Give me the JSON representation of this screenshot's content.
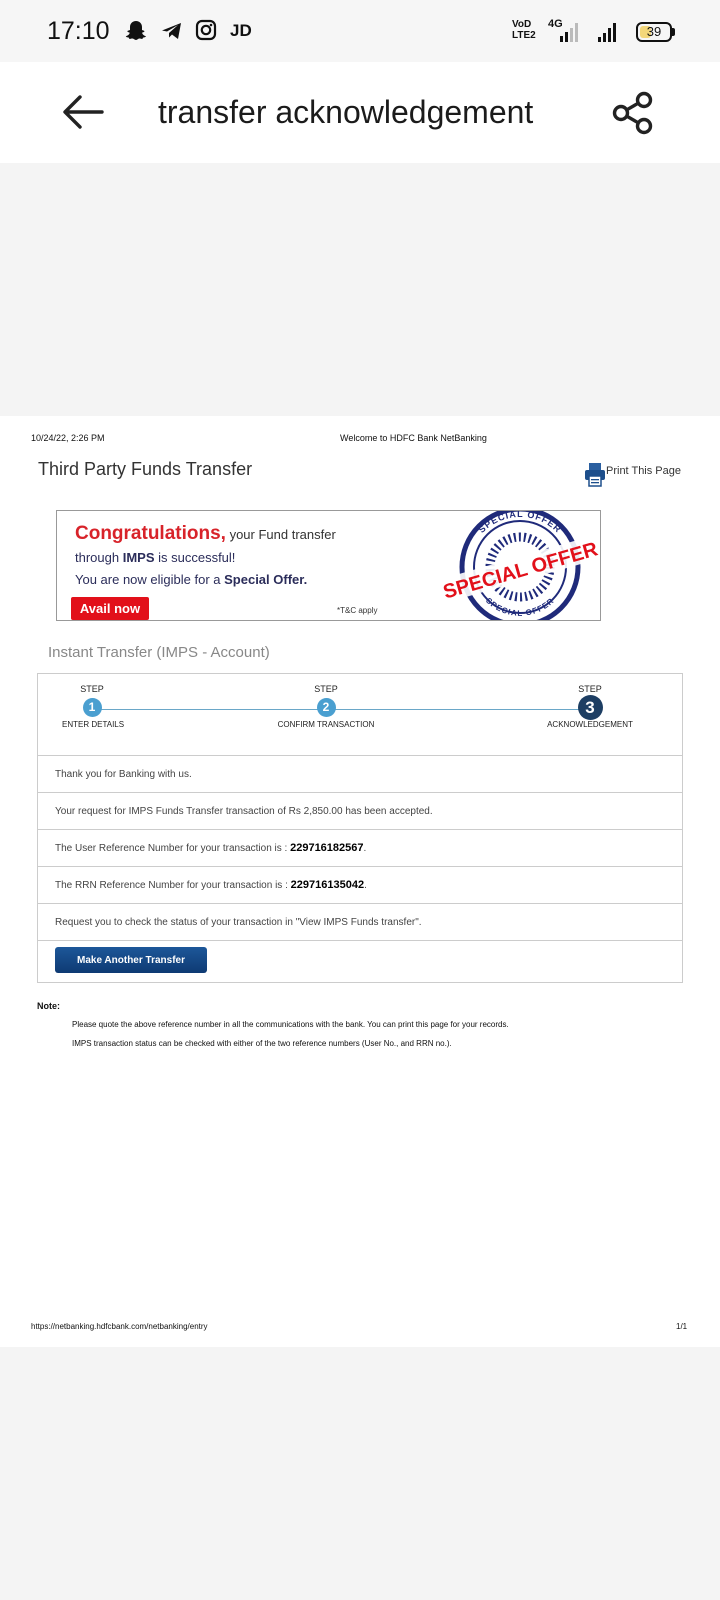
{
  "status_bar": {
    "time": "17:10",
    "jd": "JD",
    "carrier_top": "VoD",
    "carrier_bottom": "LTE2",
    "network": "4G",
    "battery": "39",
    "battery_level": 0.39
  },
  "app_bar": {
    "title": "transfer acknowledgement",
    "back_icon": "back-arrow-icon",
    "share_icon": "share-icon"
  },
  "document": {
    "header_date": "10/24/22, 2:26 PM",
    "header_title": "Welcome to HDFC Bank NetBanking",
    "section_title": "Third Party Funds Transfer",
    "print_label": "Print This Page",
    "banner": {
      "congrats": "Congratulations,",
      "line1_rest": " your Fund transfer",
      "line2_pre": "through ",
      "line2_bold": "IMPS",
      "line2_post": " is successful!",
      "line3_pre": "You are now eligible for a ",
      "line3_bold": "Special Offer.",
      "avail_button": "Avail now",
      "tc": "*T&C apply",
      "stamp_text": "SPECIAL OFFER",
      "stamp_ring_text": "SPECIAL OFFER"
    },
    "subhead": "Instant Transfer (IMPS - Account)",
    "steps": [
      {
        "word": "STEP",
        "number": "1",
        "label": "ENTER DETAILS"
      },
      {
        "word": "STEP",
        "number": "2",
        "label": "CONFIRM TRANSACTION"
      },
      {
        "word": "STEP",
        "number": "3",
        "label": "ACKNOWLEDGEMENT"
      }
    ],
    "messages": {
      "thanks": "Thank you for Banking with us.",
      "request": "Your request for IMPS Funds Transfer transaction of Rs 2,850.00 has been accepted.",
      "user_ref_label": "The User Reference Number for your transaction is : ",
      "user_ref_value": "229716182567",
      "rrn_label": "The RRN Reference Number for your transaction is : ",
      "rrn_value": "229716135042",
      "status_check": "Request you to check the status of your transaction in \"View IMPS Funds transfer\"."
    },
    "make_another_button": "Make Another Transfer",
    "note_title": "Note:",
    "note_lines": [
      "Please quote the above reference number in all the communications with the bank. You can print this page for your records.",
      "IMPS transaction status can be checked with either of the two reference numbers (User No., and RRN no.)."
    ],
    "footer_url": "https://netbanking.hdfcbank.com/netbanking/entry",
    "footer_page": "1/1"
  },
  "colors": {
    "accent_red": "#d8232a",
    "step_blue": "#4a9fd0",
    "step_active": "#1d3e63",
    "button_blue": "#0e3a73",
    "stamp_navy": "#1f2a7a"
  }
}
